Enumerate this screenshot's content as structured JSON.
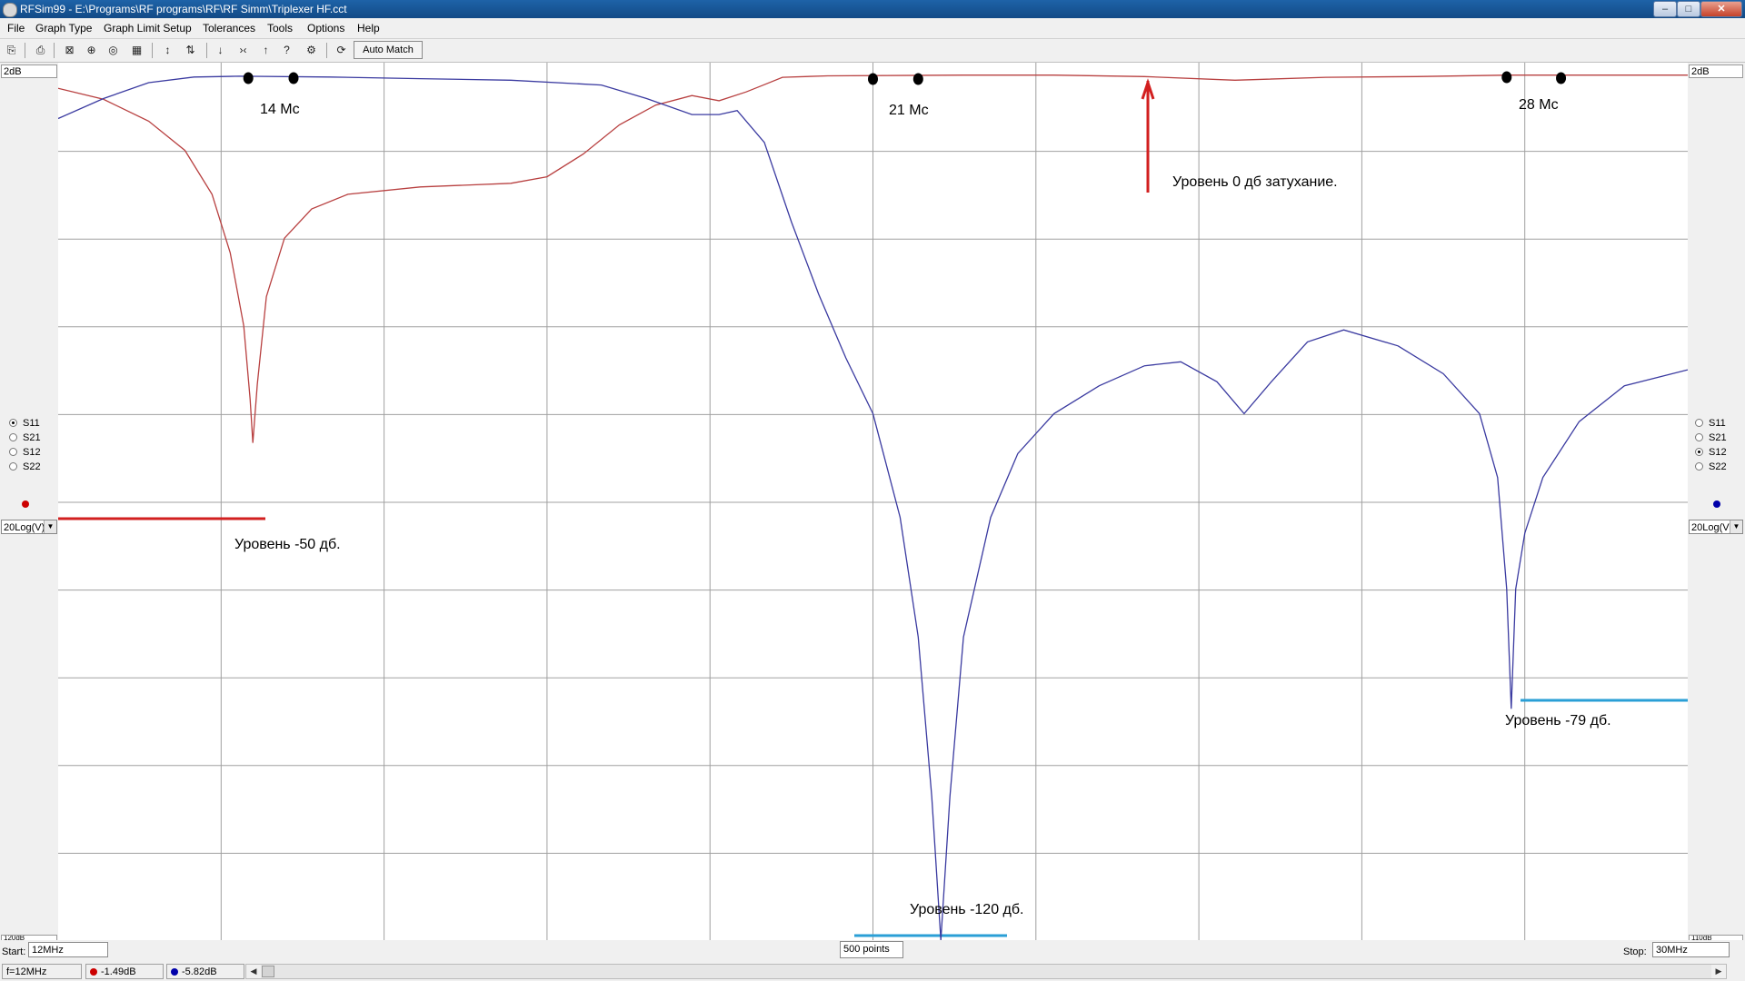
{
  "window": {
    "title": "RFSim99 - E:\\Programs\\RF programs\\RF\\RF Simm\\Triplexer HF.cct",
    "minimize": "‒",
    "maximize": "□",
    "close": "✕"
  },
  "menu": [
    "File",
    "Graph Type",
    "Graph Limit Setup",
    "Tolerances",
    "Tools",
    "Options",
    "Help"
  ],
  "toolbar": {
    "icons": [
      "open-circuit-icon",
      "print-icon",
      "rectangular-graph-icon",
      "smith-chart-icon",
      "polar-chart-icon",
      "table-icon",
      "linear-scale-icon",
      "log-scale-icon",
      "marker-down-icon",
      "marker-between-icon",
      "marker-up-icon",
      "help-icon",
      "tune-icon",
      "reset-icon"
    ],
    "glyphs": [
      "⎘",
      "⎙",
      "⊠",
      "⊕",
      "◎",
      "▦",
      "↕",
      "⇅",
      "↓",
      "›‹",
      "↑",
      "?",
      "⚙",
      "⟳"
    ],
    "auto_match": "Auto Match"
  },
  "left_axis": {
    "scale_top": "2dB",
    "scale_bottom": "120dB",
    "params": [
      {
        "label": "S11",
        "selected": true
      },
      {
        "label": "S21",
        "selected": false
      },
      {
        "label": "S12",
        "selected": false
      },
      {
        "label": "S22",
        "selected": false
      }
    ],
    "trace_color": "#cc0000",
    "format": "20Log(V)"
  },
  "right_axis": {
    "scale_top": "2dB",
    "scale_bottom": "110dB",
    "params": [
      {
        "label": "S11",
        "selected": false
      },
      {
        "label": "S21",
        "selected": false
      },
      {
        "label": "S12",
        "selected": true
      },
      {
        "label": "S22",
        "selected": false
      }
    ],
    "trace_color": "#0000aa",
    "format": "20Log(V)"
  },
  "plot": {
    "grid_color": "#a0a0a0",
    "colors": {
      "s11": "#b84040",
      "s12": "#3a3aa0",
      "annot_red": "#d21f1f",
      "annot_blue": "#2a9fd6"
    }
  },
  "annotations": {
    "band14": "14 Mc",
    "band21": "21 Mc",
    "band28": "28 Mc",
    "level0": "Уровень 0 дб затухание.",
    "level50": "Уровень -50 дб.",
    "level120": "Уровень -120 дб.",
    "level79": "Уровень -79 дб."
  },
  "bottom": {
    "start_label": "Start:",
    "start_value": "12MHz",
    "points": "500 points",
    "stop_label": "Stop:",
    "stop_value": "30MHz",
    "cursor_freq": "f=12MHz",
    "s11_value": "-1.49dB",
    "s12_value": "-5.82dB"
  },
  "chart_data": {
    "type": "line",
    "xlim": [
      12,
      30
    ],
    "x_unit": "MHz",
    "ylim_left": [
      -118,
      2
    ],
    "ylim_right": [
      -108,
      2
    ],
    "grid": true,
    "series": [
      {
        "name": "S11",
        "axis": "left",
        "color": "#b84040",
        "points": [
          [
            12.0,
            -1.5
          ],
          [
            12.5,
            -3
          ],
          [
            13.0,
            -6
          ],
          [
            13.4,
            -10
          ],
          [
            13.7,
            -16
          ],
          [
            13.9,
            -24
          ],
          [
            14.05,
            -34
          ],
          [
            14.12,
            -44
          ],
          [
            14.15,
            -50
          ],
          [
            14.2,
            -42
          ],
          [
            14.3,
            -30
          ],
          [
            14.5,
            -22
          ],
          [
            14.8,
            -18
          ],
          [
            15.2,
            -16
          ],
          [
            16.0,
            -15
          ],
          [
            17.0,
            -14.5
          ],
          [
            17.4,
            -13.6
          ],
          [
            17.8,
            -10.5
          ],
          [
            18.2,
            -6.5
          ],
          [
            18.6,
            -3.8
          ],
          [
            19.0,
            -2.5
          ],
          [
            19.3,
            -3.2
          ],
          [
            19.6,
            -2
          ],
          [
            19.8,
            -1
          ],
          [
            20.0,
            0
          ],
          [
            20.5,
            0.2
          ],
          [
            22.0,
            0.3
          ],
          [
            23.0,
            0.3
          ],
          [
            24.0,
            0.1
          ],
          [
            25.0,
            -0.4
          ],
          [
            26.0,
            0
          ],
          [
            27.0,
            0.1
          ],
          [
            28.0,
            0.3
          ],
          [
            29.0,
            0.3
          ],
          [
            30.0,
            0.3
          ]
        ]
      },
      {
        "name": "S12",
        "axis": "right",
        "color": "#3a3aa0",
        "points": [
          [
            12.0,
            -5
          ],
          [
            12.5,
            -2.5
          ],
          [
            13.0,
            -0.5
          ],
          [
            13.5,
            0.2
          ],
          [
            14.0,
            0.3
          ],
          [
            15.0,
            0.2
          ],
          [
            16.0,
            0
          ],
          [
            17.0,
            -0.2
          ],
          [
            18.0,
            -0.8
          ],
          [
            18.5,
            -2.5
          ],
          [
            19.0,
            -4.5
          ],
          [
            19.3,
            -4.5
          ],
          [
            19.5,
            -4
          ],
          [
            19.8,
            -8
          ],
          [
            20.1,
            -18
          ],
          [
            20.4,
            -27
          ],
          [
            20.7,
            -35
          ],
          [
            21.0,
            -42
          ],
          [
            21.3,
            -55
          ],
          [
            21.5,
            -70
          ],
          [
            21.65,
            -90
          ],
          [
            21.75,
            -108
          ],
          [
            21.85,
            -90
          ],
          [
            22.0,
            -70
          ],
          [
            22.3,
            -55
          ],
          [
            22.6,
            -47
          ],
          [
            23.0,
            -42
          ],
          [
            23.5,
            -38.5
          ],
          [
            24.0,
            -36
          ],
          [
            24.4,
            -35.5
          ],
          [
            24.8,
            -38
          ],
          [
            25.1,
            -42
          ],
          [
            25.4,
            -38
          ],
          [
            25.8,
            -33
          ],
          [
            26.2,
            -31.5
          ],
          [
            26.8,
            -33.5
          ],
          [
            27.3,
            -37
          ],
          [
            27.7,
            -42
          ],
          [
            27.9,
            -50
          ],
          [
            28.0,
            -64
          ],
          [
            28.05,
            -79
          ],
          [
            28.1,
            -64
          ],
          [
            28.2,
            -57
          ],
          [
            28.4,
            -50
          ],
          [
            28.8,
            -43
          ],
          [
            29.3,
            -38.5
          ],
          [
            30.0,
            -36.5
          ]
        ]
      }
    ]
  }
}
